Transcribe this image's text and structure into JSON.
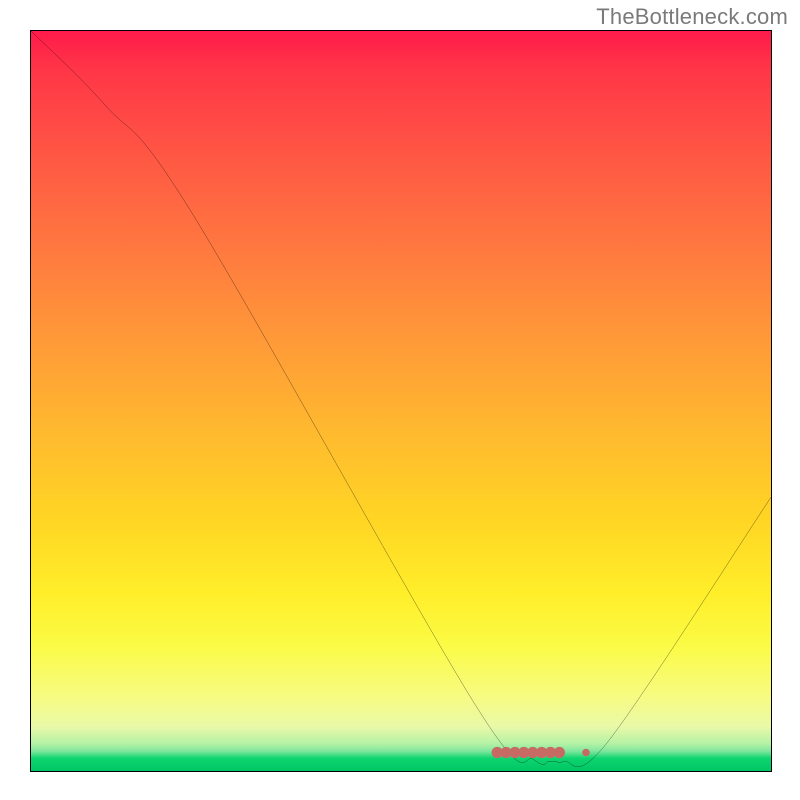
{
  "watermark": "TheBottleneck.com",
  "chart_data": {
    "type": "line",
    "title": "",
    "xlabel": "",
    "ylabel": "",
    "xlim": [
      0,
      100
    ],
    "ylim": [
      0,
      100
    ],
    "grid": false,
    "legend": false,
    "series": [
      {
        "name": "curve",
        "x": [
          0,
          10,
          22,
          60,
          68,
          70,
          71,
          72,
          78,
          100
        ],
        "values": [
          100,
          90,
          75,
          9,
          1.5,
          1.3,
          1.3,
          1.3,
          4,
          37
        ]
      }
    ],
    "markers": {
      "x": [
        63.0,
        64.2,
        65.4,
        66.6,
        67.8,
        69.0,
        70.2,
        71.4,
        75.0
      ],
      "y": [
        2.5,
        2.5,
        2.5,
        2.5,
        2.5,
        2.5,
        2.5,
        2.5,
        2.5
      ],
      "radius_main": 5.6,
      "radius_outlier": 3.8,
      "color": "#c76a64"
    },
    "background_gradient": {
      "stops": [
        {
          "pos": 0,
          "color": "#ff1a4a"
        },
        {
          "pos": 0.5,
          "color": "#ffb92f"
        },
        {
          "pos": 0.83,
          "color": "#fbfb45"
        },
        {
          "pos": 0.97,
          "color": "#7fe79d"
        },
        {
          "pos": 1.0,
          "color": "#00c665"
        }
      ]
    }
  }
}
